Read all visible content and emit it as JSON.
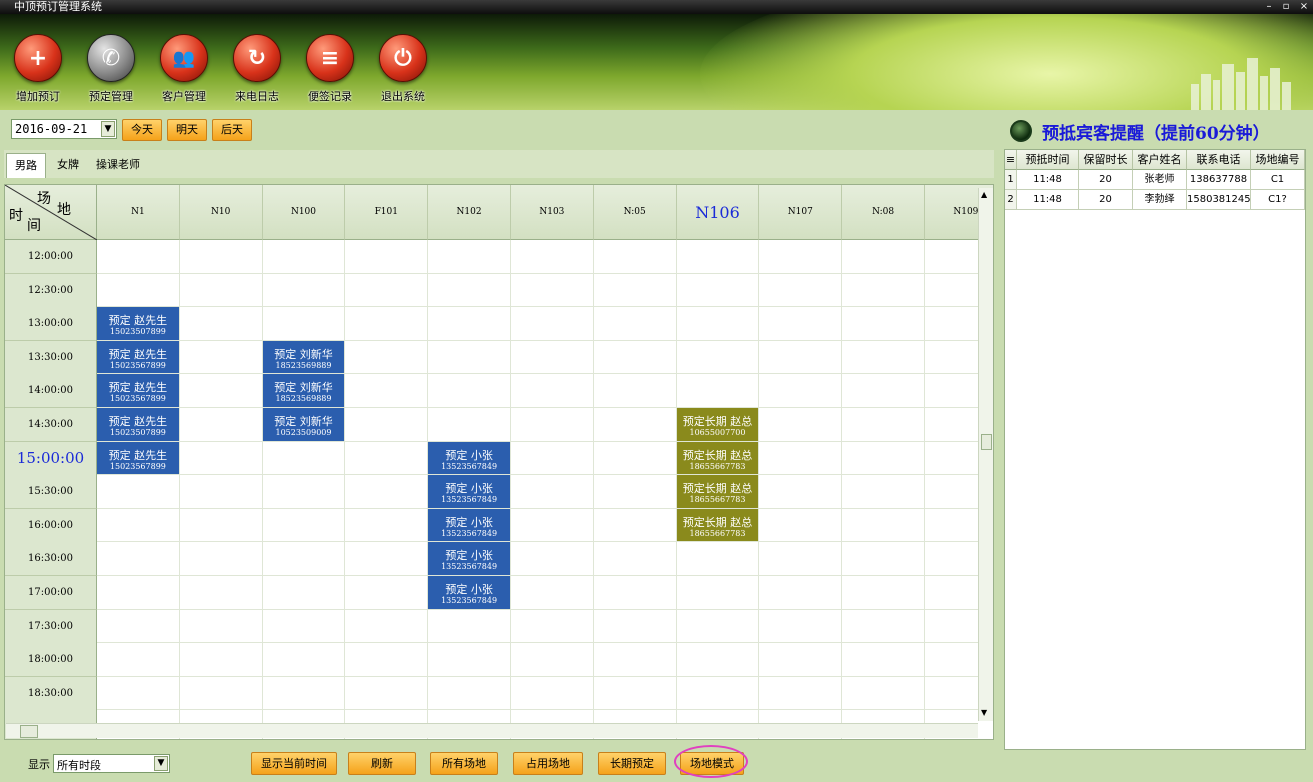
{
  "window": {
    "title": "中顶预订管理系统",
    "controls": [
      "–",
      "▫",
      "×"
    ]
  },
  "toolbar": [
    {
      "label": "增加预订",
      "icon": "add-booking-icon",
      "glyph": "+"
    },
    {
      "label": "预定管理",
      "icon": "phone-icon",
      "glyph": "✆"
    },
    {
      "label": "客户管理",
      "icon": "customers-icon",
      "glyph": "👥"
    },
    {
      "label": "来电日志",
      "icon": "call-log-icon",
      "glyph": "↻"
    },
    {
      "label": "便签记录",
      "icon": "notes-icon",
      "glyph": "≡"
    },
    {
      "label": "退出系统",
      "icon": "power-icon",
      "glyph": "⏻"
    }
  ],
  "date": {
    "value": "2016-09-21",
    "buttons": [
      "今天",
      "明天",
      "后天"
    ]
  },
  "tabs": [
    "男路",
    "女牌",
    "操课老师"
  ],
  "grid": {
    "corner": {
      "top": "场",
      "right": "地",
      "left": "时",
      "bottom": "间"
    },
    "columns": [
      "N1",
      "N10",
      "N100",
      "F101",
      "N102",
      "N103",
      "N:05",
      "N106",
      "N107",
      "N:08",
      "N109"
    ],
    "highlight_column": "N106",
    "times": [
      "12:00:00",
      "12:30:00",
      "13:00:00",
      "13:30:00",
      "14:00:00",
      "14:30:00",
      "15:00:00",
      "15:30:00",
      "16:00:00",
      "16:30:00",
      "17:00:00",
      "17:30:00",
      "18:00:00",
      "18:30:00",
      "..."
    ],
    "highlight_time": "15:00:00",
    "bookings": [
      {
        "col": 0,
        "row": 2,
        "name": "预定 赵先生",
        "phone": "15023507899",
        "type": "blue"
      },
      {
        "col": 0,
        "row": 3,
        "name": "预定 赵先生",
        "phone": "15023567899",
        "type": "blue"
      },
      {
        "col": 0,
        "row": 4,
        "name": "预定 赵先生",
        "phone": "15023567899",
        "type": "blue"
      },
      {
        "col": 0,
        "row": 5,
        "name": "预定 赵先生",
        "phone": "15023507899",
        "type": "blue"
      },
      {
        "col": 0,
        "row": 6,
        "name": "预定 赵先生",
        "phone": "15023567899",
        "type": "blue"
      },
      {
        "col": 2,
        "row": 3,
        "name": "预定 刘新华",
        "phone": "18523569889",
        "type": "blue"
      },
      {
        "col": 2,
        "row": 4,
        "name": "预定 刘新华",
        "phone": "18523569889",
        "type": "blue"
      },
      {
        "col": 2,
        "row": 5,
        "name": "预定 刘新华",
        "phone": "10523509009",
        "type": "blue"
      },
      {
        "col": 4,
        "row": 6,
        "name": "预定 小张",
        "phone": "13523567849",
        "type": "blue"
      },
      {
        "col": 4,
        "row": 7,
        "name": "预定 小张",
        "phone": "13523567849",
        "type": "blue"
      },
      {
        "col": 4,
        "row": 8,
        "name": "预定 小张",
        "phone": "13523567849",
        "type": "blue"
      },
      {
        "col": 4,
        "row": 9,
        "name": "预定 小张",
        "phone": "13523567849",
        "type": "blue"
      },
      {
        "col": 4,
        "row": 10,
        "name": "预定 小张",
        "phone": "13523567849",
        "type": "blue"
      },
      {
        "col": 7,
        "row": 5,
        "name": "预定长期 赵总",
        "phone": "10655007700",
        "type": "olive"
      },
      {
        "col": 7,
        "row": 6,
        "name": "预定长期 赵总",
        "phone": "18655667783",
        "type": "olive"
      },
      {
        "col": 7,
        "row": 7,
        "name": "预定长期 赵总",
        "phone": "18655667783",
        "type": "olive"
      },
      {
        "col": 7,
        "row": 8,
        "name": "预定长期 赵总",
        "phone": "18655667783",
        "type": "olive"
      }
    ]
  },
  "bottom": {
    "display_label": "显示",
    "display_select": "所有时段",
    "buttons": [
      "显示当前时间",
      "刷新",
      "所有场地",
      "占用场地",
      "长期预定",
      "场地模式"
    ]
  },
  "reminder": {
    "title": "预抵宾客提醒（提前60分钟）",
    "columns": [
      "预抵时间",
      "保留时长",
      "客户姓名",
      "联系电话",
      "场地编号"
    ],
    "rows": [
      {
        "idx": "1",
        "time": "11:48",
        "hold": "20",
        "name": "张老师",
        "phone": "138637788",
        "court": "C1"
      },
      {
        "idx": "2",
        "time": "11:48",
        "hold": "20",
        "name": "李勃绎",
        "phone": "1580381245",
        "court": "C1?"
      }
    ]
  },
  "colors": {
    "booking_blue": "#2b5eae",
    "booking_longterm": "#8a8a1c",
    "button_orange": "#f5a21a",
    "highlight_circle": "#e040c0"
  }
}
